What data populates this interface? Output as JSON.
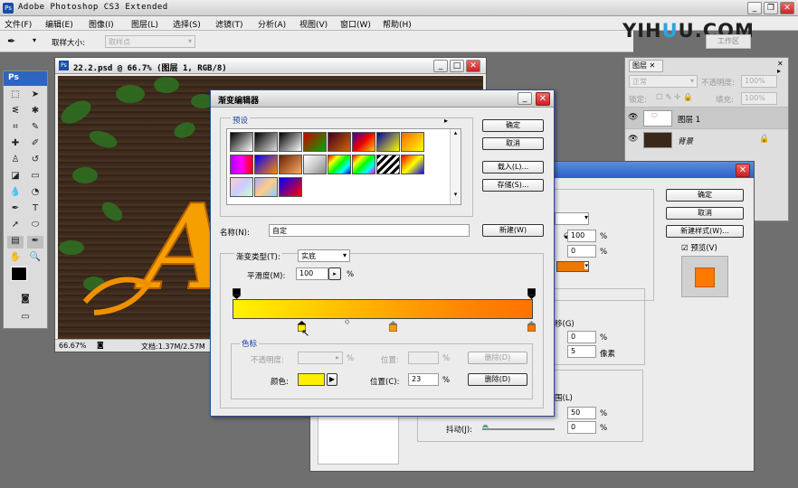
{
  "window": {
    "title": "Adobe Photoshop CS3 Extended"
  },
  "menu": [
    "文件(F)",
    "编辑(E)",
    "图像(I)",
    "图层(L)",
    "选择(S)",
    "滤镜(T)",
    "分析(A)",
    "视图(V)",
    "窗口(W)",
    "帮助(H)"
  ],
  "options": {
    "sample_size_label": "取样大小:",
    "sample_size_value": "取样点"
  },
  "brand": {
    "a": "YIH",
    "b": "U",
    "c": "U.COM"
  },
  "workspace_label": "工作区",
  "toolbox": {
    "logo": "Ps"
  },
  "document": {
    "title": "22.2.psd @ 66.7% (图层 1, RGB/8)",
    "zoom": "66.67%",
    "doc_info": "文档:1.37M/2.57M",
    "canvas_letter": "A"
  },
  "layers_panel": {
    "tab": "图层",
    "blend_mode": "正常",
    "opacity_label": "不透明度:",
    "opacity_value": "100%",
    "lock_label": "锁定:",
    "fill_label": "填充:",
    "fill_value": "100%",
    "layers": [
      {
        "name": "图层 1",
        "italic": false
      },
      {
        "name": "背景",
        "italic": true
      }
    ]
  },
  "layer_style": {
    "ok": "确定",
    "cancel": "取消",
    "new_style": "新建样式(W)...",
    "preview_label": "预览(V)",
    "value1": "100",
    "value2": "0",
    "pct": "%",
    "offset_label": "移(G)",
    "offset1": "0",
    "offset2": "5",
    "pixels": "像素",
    "range_label": "围(L)",
    "range_value": "50",
    "jitter_label": "抖动(J):",
    "jitter_value": "0"
  },
  "gradient_editor": {
    "title": "渐变编辑器",
    "presets_label": "预设",
    "ok": "确定",
    "cancel": "取消",
    "load": "载入(L)...",
    "save": "存储(S)...",
    "name_label": "名称(N):",
    "name_value": "自定",
    "new_btn": "新建(W)",
    "type_label": "渐变类型(T):",
    "type_value": "实底",
    "smooth_label": "平滑度(M):",
    "smooth_value": "100",
    "pct": "%",
    "stops_group": "色标",
    "opacity_label": "不透明度:",
    "location_label": "位置:",
    "delete_label": "删除(D)",
    "color_label": "颜色:",
    "color_location_label": "位置(C):",
    "color_location_value": "23",
    "colors": {
      "stop_color": "#ffef00"
    }
  }
}
